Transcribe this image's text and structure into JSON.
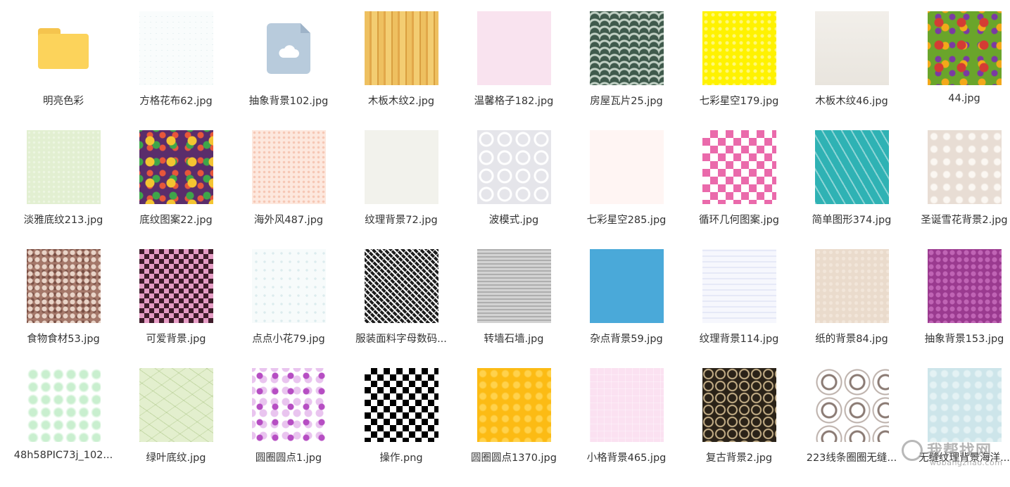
{
  "items": [
    {
      "label": "明亮色彩",
      "type": "folder"
    },
    {
      "label": "方格花布62.jpg",
      "pattern": "p-grid"
    },
    {
      "label": "抽象背景102.jpg",
      "type": "file"
    },
    {
      "label": "木板木纹2.jpg",
      "pattern": "p-wood1"
    },
    {
      "label": "温馨格子182.jpg",
      "pattern": "p-pink"
    },
    {
      "label": "房屋瓦片25.jpg",
      "pattern": "p-tiles"
    },
    {
      "label": "七彩星空179.jpg",
      "pattern": "p-yellow"
    },
    {
      "label": "木板木纹46.jpg",
      "pattern": "p-wood2"
    },
    {
      "label": "44.jpg",
      "pattern": "p-colorful"
    },
    {
      "label": "淡雅底纹213.jpg",
      "pattern": "p-lightgreen"
    },
    {
      "label": "底纹图案22.jpg",
      "pattern": "p-purplecol"
    },
    {
      "label": "海外风487.jpg",
      "pattern": "p-dots-peach"
    },
    {
      "label": "纹理背景72.jpg",
      "pattern": "p-offwhite"
    },
    {
      "label": "波模式.jpg",
      "pattern": "p-swirl"
    },
    {
      "label": "七彩星空285.jpg",
      "pattern": "p-pinkwhite"
    },
    {
      "label": "循环几何图案.jpg",
      "pattern": "p-pinkgeo"
    },
    {
      "label": "简单图形374.jpg",
      "pattern": "p-teal"
    },
    {
      "label": "圣诞雪花背景2.jpg",
      "pattern": "p-snow"
    },
    {
      "label": "食物食材53.jpg",
      "pattern": "p-food"
    },
    {
      "label": "可爱背景.jpg",
      "pattern": "p-cute"
    },
    {
      "label": "点点小花79.jpg",
      "pattern": "p-flowerdots"
    },
    {
      "label": "服装面料字母数码...",
      "pattern": "p-bwletters"
    },
    {
      "label": "转墙石墙.jpg",
      "pattern": "p-stone"
    },
    {
      "label": "杂点背景59.jpg",
      "pattern": "p-blue"
    },
    {
      "label": "纹理背景114.jpg",
      "pattern": "p-lavender"
    },
    {
      "label": "纸的背景84.jpg",
      "pattern": "p-paper"
    },
    {
      "label": "抽象背景153.jpg",
      "pattern": "p-purple"
    },
    {
      "label": "48h58PIC73j_102...",
      "pattern": "p-greenbokeh"
    },
    {
      "label": "绿叶底纹.jpg",
      "pattern": "p-leaf"
    },
    {
      "label": "圆圈圆点1.jpg",
      "pattern": "p-circles"
    },
    {
      "label": "操作.png",
      "pattern": "p-houndstooth"
    },
    {
      "label": "圆圈圆点1370.jpg",
      "pattern": "p-orange"
    },
    {
      "label": "小格背景465.jpg",
      "pattern": "p-pinkcheck"
    },
    {
      "label": "复古背景2.jpg",
      "pattern": "p-retro"
    },
    {
      "label": "223线条圈圈无缝...",
      "pattern": "p-lines"
    },
    {
      "label": "无缝纹理背景海洋...",
      "pattern": "p-ocean"
    }
  ],
  "watermark": {
    "text": "我帮找网",
    "domain": "wobangzhao.com"
  }
}
